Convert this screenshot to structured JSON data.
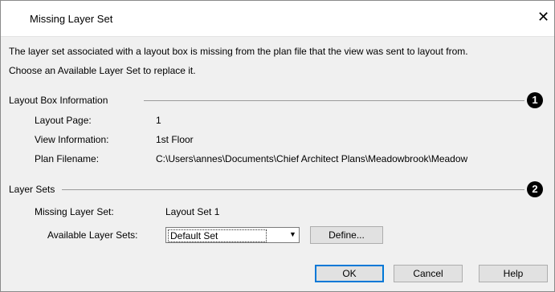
{
  "dialog": {
    "title": "Missing Layer Set",
    "close_icon": "close-icon",
    "description_line1": "The layer set associated with a layout box is missing from the plan file that the view was sent to layout from.",
    "description_line2": "Choose an Available Layer Set to replace it."
  },
  "layout_box": {
    "heading": "Layout Box Information",
    "marker": "1",
    "page_label": "Layout Page:",
    "page_value": "1",
    "view_label": "View Information:",
    "view_value": "1st Floor",
    "plan_label": "Plan Filename:",
    "plan_value": "C:\\Users\\annes\\Documents\\Chief Architect Plans\\Meadowbrook\\Meadow"
  },
  "layer_sets": {
    "heading": "Layer Sets",
    "marker": "2",
    "missing_label": "Missing Layer Set:",
    "missing_value": "Layout Set 1",
    "available_label": "Available Layer Sets:",
    "available_value": "Default Set",
    "define_label": "Define..."
  },
  "buttons": {
    "ok": "OK",
    "cancel": "Cancel",
    "help": "Help"
  },
  "colors": {
    "dialog_bg": "#f0f0f0",
    "default_button_border": "#0078d7"
  }
}
